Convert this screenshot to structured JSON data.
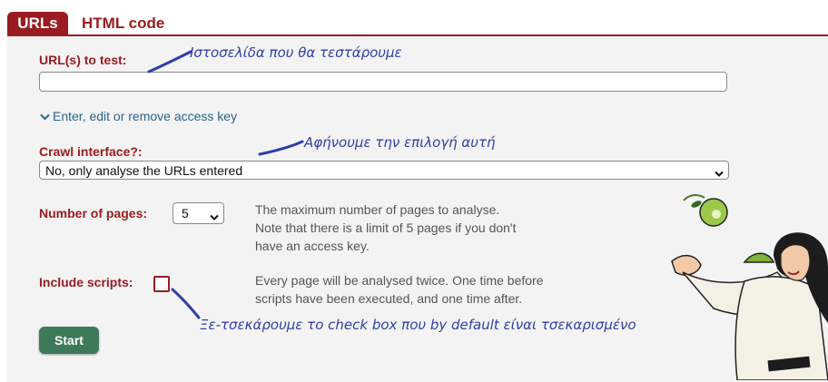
{
  "tabs": {
    "active": "URLs",
    "other": "HTML code"
  },
  "form": {
    "urls_label": "URL(s) to test:",
    "urls_value": "",
    "access_key_link": "Enter, edit or remove access key",
    "crawl_label": "Crawl interface?:",
    "crawl_selected": "No, only analyse the URLs entered",
    "pages_label": "Number of pages:",
    "pages_selected": "5",
    "pages_help_1": "The maximum number of pages to analyse.",
    "pages_help_2": "Note that there is a limit of 5 pages if you don't",
    "pages_help_3": "have an access key.",
    "scripts_label": "Include scripts:",
    "scripts_checked": false,
    "scripts_help_1": "Every page will be analysed twice. One time before",
    "scripts_help_2": "scripts have been executed, and one time after.",
    "start_label": "Start"
  },
  "annotations": {
    "urls_note": "Ιστοσελίδα που θα τεστάρουμε",
    "crawl_note": "Αφήνουμε την επιλογή αυτή",
    "scripts_note": "Ξε-τσεκάρουμε το check box που by default είναι τσεκαρισμένο"
  },
  "icons": {
    "access_key_chevron": "chevron-down-icon",
    "select_arrow": "chevron-down-icon",
    "illustration": "chef-with-fruit-illustration"
  },
  "colors": {
    "brand": "#9a1c20",
    "link": "#27648e",
    "button": "#3d7a5a",
    "annotation": "#2f3fa8"
  }
}
